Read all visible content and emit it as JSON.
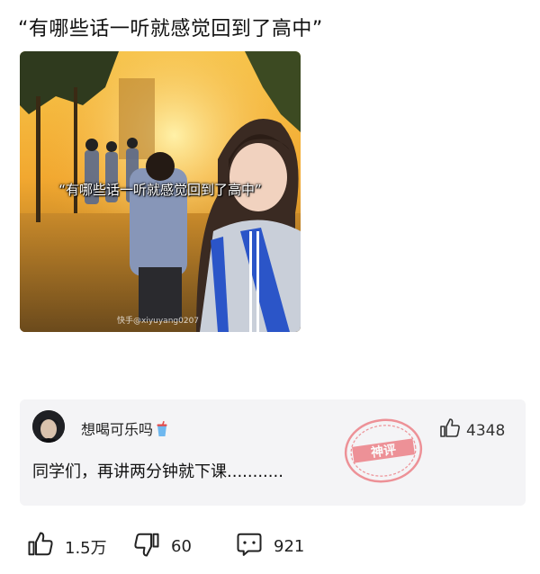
{
  "post": {
    "title": "“有哪些话一听就感觉回到了高中”",
    "image": {
      "caption": "“有哪些话一听就感觉回到了高中”",
      "watermark": "快手@xiyuyang0207"
    }
  },
  "comment": {
    "username": "想喝可乐吗",
    "text": "同学们，再讲两分钟就下课...........",
    "likes": "4348",
    "stamp": "神评",
    "icons": [
      "avatar",
      "cola-cup-icon",
      "thumbs-up-icon"
    ]
  },
  "actions": {
    "like_count": "1.5万",
    "dislike_count": "60",
    "comment_count": "921",
    "icons": [
      "thumbs-up-icon",
      "thumbs-down-icon",
      "comment-bubble-icon"
    ]
  },
  "colors": {
    "background": "#ffffff",
    "card_background": "#f4f4f6",
    "stamp_red": "#e8424a",
    "sunset_gold": "#f2b33a"
  }
}
